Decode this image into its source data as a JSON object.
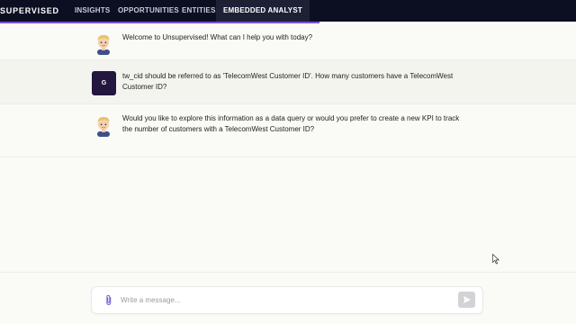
{
  "header": {
    "brand": "SUPERVISED",
    "tabs": [
      {
        "label": "INSIGHTS",
        "active": false
      },
      {
        "label": "OPPORTUNITIES",
        "active": false
      },
      {
        "label": "ENTITIES",
        "active": false
      },
      {
        "label": "EMBEDDED ANALYST",
        "active": true
      }
    ],
    "progress": 0.555,
    "accent_color": "#7b4fd6"
  },
  "conversation": {
    "messages": [
      {
        "role": "assistant",
        "avatar": "memoji-avatar",
        "text": "Welcome to Unsupervised! What can I help you with today?"
      },
      {
        "role": "user",
        "avatar_letter": "G",
        "text": "tw_cid should be referred to as 'TelecomWest Customer ID'. How many customers have a TelecomWest Customer ID?"
      },
      {
        "role": "assistant",
        "avatar": "memoji-avatar",
        "text": "Would you like to explore this information as a data query or would you prefer to create a new KPI to track the number of customers with a TelecomWest Customer ID?"
      }
    ]
  },
  "composer": {
    "placeholder": "Write a message...",
    "value": "",
    "attach_icon": "paperclip-icon",
    "send_icon": "send-icon"
  }
}
